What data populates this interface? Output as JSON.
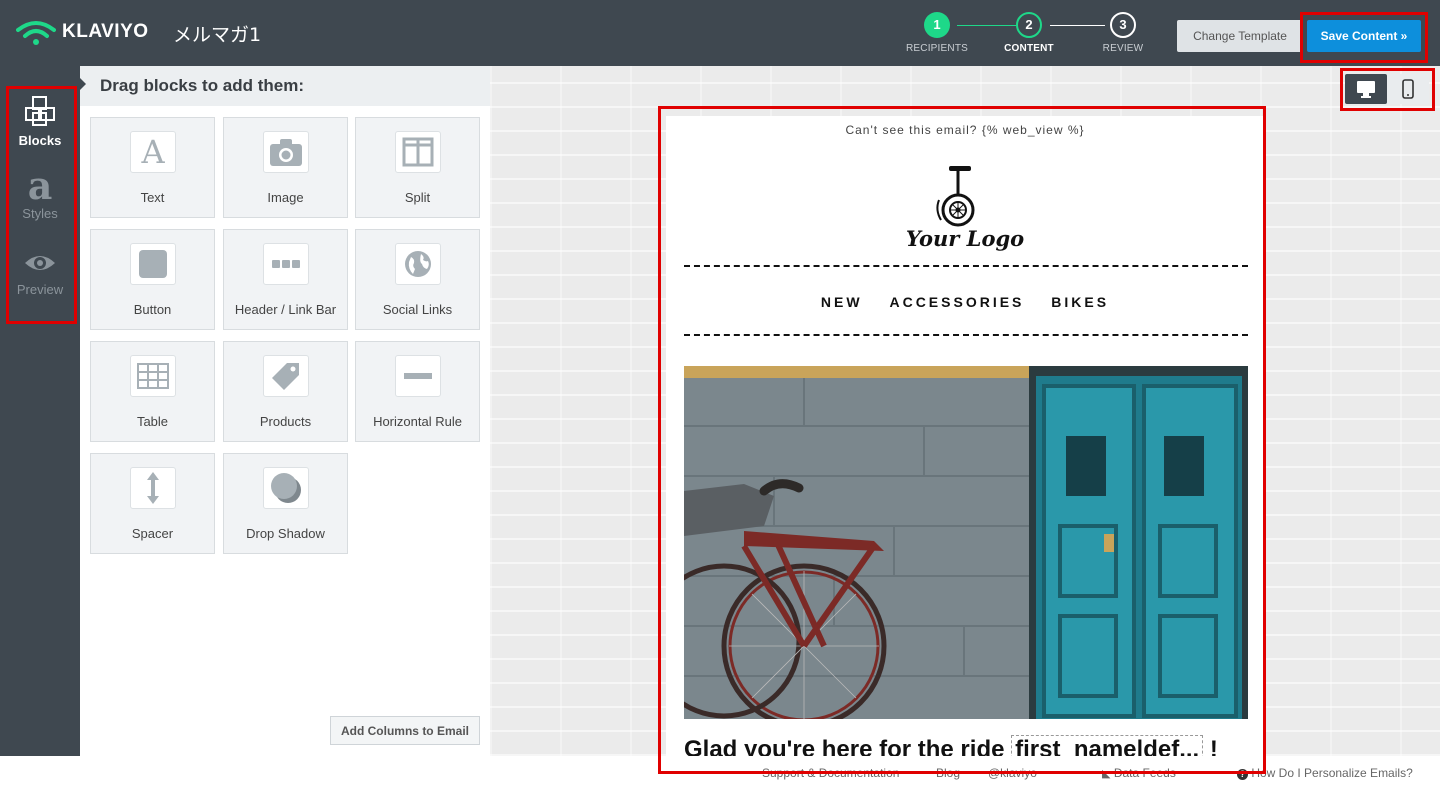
{
  "app": {
    "brand": "KLAVIYO",
    "campaign_title": "メルマガ1"
  },
  "steps": [
    {
      "num": "1",
      "label": "RECIPIENTS",
      "state": "done"
    },
    {
      "num": "2",
      "label": "CONTENT",
      "state": "active"
    },
    {
      "num": "3",
      "label": "REVIEW",
      "state": "todo"
    }
  ],
  "toolbar": {
    "change_template": "Change Template",
    "save_content": "Save Content »"
  },
  "rail": {
    "blocks": "Blocks",
    "styles": "Styles",
    "preview": "Preview",
    "styles_glyph": "a"
  },
  "panel": {
    "heading": "Drag blocks to add them:",
    "blocks": [
      "Text",
      "Image",
      "Split",
      "Button",
      "Header / Link Bar",
      "Social Links",
      "Table",
      "Products",
      "Horizontal Rule",
      "Spacer",
      "Drop Shadow"
    ],
    "text_glyph": "A",
    "add_columns": "Add Columns to Email"
  },
  "email": {
    "webview": "Can't see this email? {% web_view %}",
    "logo_caption": "Your Logo",
    "nav": [
      "NEW",
      "ACCESSORIES",
      "BIKES"
    ],
    "headline_prefix": "Glad you're here for the ride",
    "headline_tag": "first_name|def...",
    "headline_suffix": "!"
  },
  "footer": {
    "support": "Support & Documentation",
    "blog": "Blog",
    "twitter": "@klaviyo",
    "data_feeds": "Data Feeds",
    "personalize": "How Do I Personalize Emails?"
  },
  "colors": {
    "topbar": "#3f4850",
    "accent_green": "#1ed889",
    "save_blue": "#0d8fdc",
    "highlight_red": "#e00000"
  }
}
